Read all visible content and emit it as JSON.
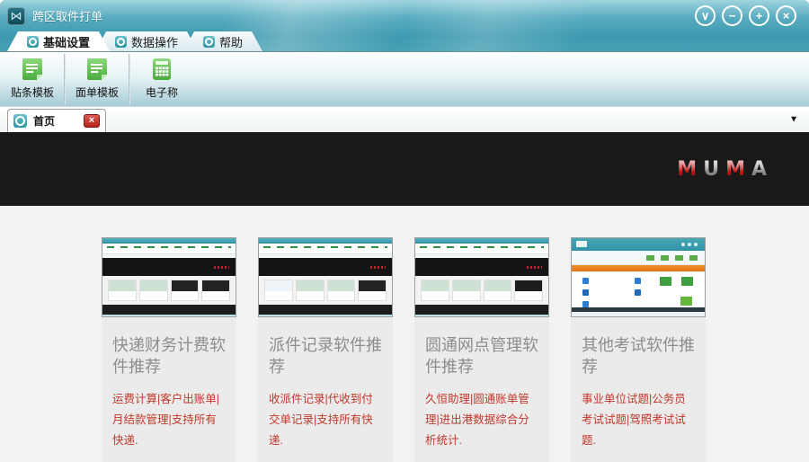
{
  "window": {
    "title": "跨区取件打单",
    "app_icon": "bowtie",
    "app_icon_glyph": "⋈",
    "controls": [
      {
        "name": "skin-menu",
        "glyph": "∨"
      },
      {
        "name": "minimize",
        "glyph": "−"
      },
      {
        "name": "maximize",
        "glyph": "+"
      },
      {
        "name": "close",
        "glyph": "×"
      }
    ]
  },
  "tabs": [
    {
      "label": "基础设置",
      "active": true
    },
    {
      "label": "数据操作",
      "active": false
    },
    {
      "label": "帮助",
      "active": false
    }
  ],
  "toolbar": {
    "buttons": [
      {
        "label": "贴条模板",
        "icon": "document-template-icon"
      },
      {
        "label": "面单模板",
        "icon": "document-template-icon"
      },
      {
        "label": "电子称",
        "icon": "calculator-scale-icon"
      }
    ]
  },
  "tabstrip": {
    "active_tab_label": "首页",
    "close_glyph": "×",
    "overflow_glyph": "▼"
  },
  "banner": {
    "brand": "MUMA",
    "letters": [
      "M",
      "U",
      "M",
      "A"
    ]
  },
  "cards": [
    {
      "title": "快递财务计费软件推荐",
      "desc": "运费计算|客户出账单|月结款管理|支持所有快递.",
      "thumb": "site-a"
    },
    {
      "title": "派件记录软件推荐",
      "desc": "收派件记录|代收到付交单记录|支持所有快递.",
      "thumb": "site-b"
    },
    {
      "title": "圆通网点管理软件推荐",
      "desc": "久恒助理|圆通账单管理|进出港数据综合分析统计.",
      "thumb": "site-c"
    },
    {
      "title": "其他考试软件推荐",
      "desc": "事业单位试题|公务员考试试题|驾照考试试题.",
      "thumb": "app"
    }
  ],
  "colors": {
    "titlebar_teal": "#3e9ab0",
    "toolbar_teal_bottom": "#a6ccd7",
    "banner_black": "#191919",
    "content_bg": "#f2f2f2",
    "card_bg": "#ebebeb",
    "card_title_gray": "#8d8d8d",
    "card_desc_red": "#c0392b",
    "logo_red": "#c01414",
    "logo_silver": "#8a8a8a",
    "close_button_red": "#b3241c",
    "tab_icon_teal": "#2e93a4",
    "toolbar_icon_green": "#4aab3c"
  }
}
